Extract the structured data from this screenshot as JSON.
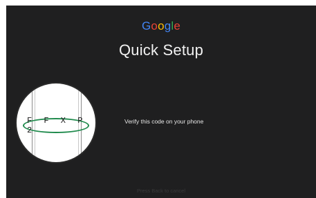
{
  "logo": {
    "letters": [
      "G",
      "o",
      "o",
      "g",
      "l",
      "e"
    ],
    "colors": [
      "#4285F4",
      "#EA4335",
      "#FBBC05",
      "#4285F4",
      "#34A853",
      "#EA4335"
    ]
  },
  "title": "Quick Setup",
  "code": "F F X P 2",
  "instruction": "Verify this code on your phone",
  "hint": "Press Back to cancel",
  "colors": {
    "background": "#1f1f20",
    "code_outline": "#1f8a4c",
    "text": "#f2f2f2"
  }
}
